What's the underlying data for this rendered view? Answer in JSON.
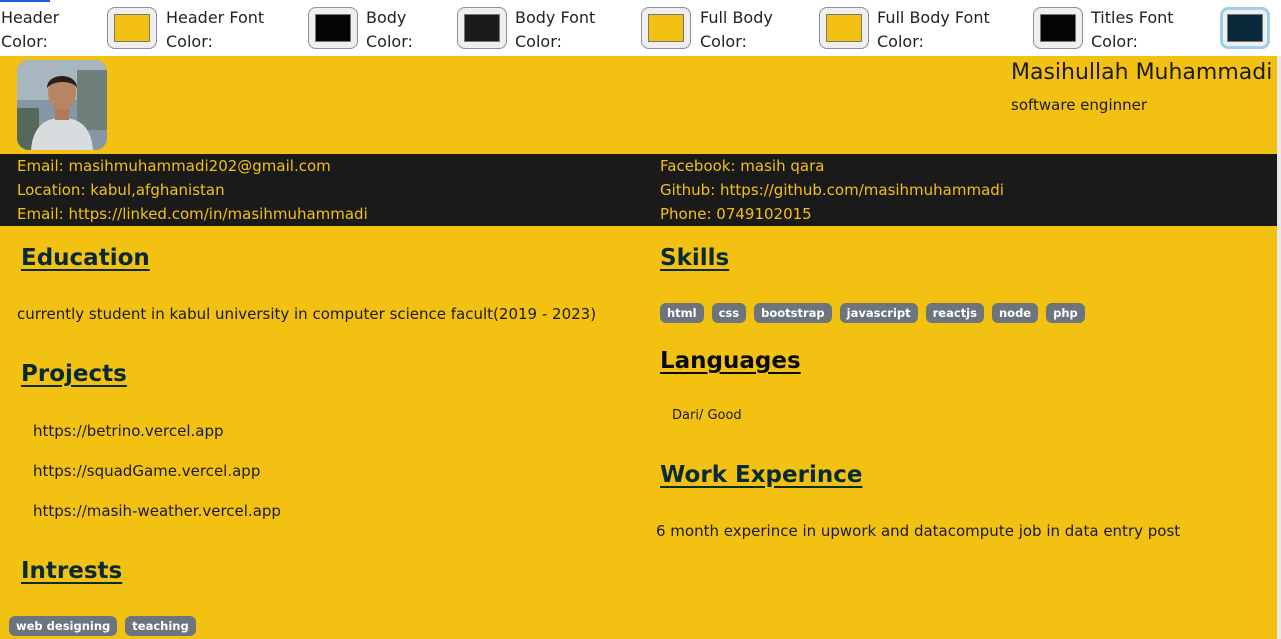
{
  "toolbar": {
    "header_color": {
      "label_line1": "Header",
      "label_line2": "Color:",
      "value": "#f2c112"
    },
    "header_font_color": {
      "label_line1": "Header Font",
      "label_line2": "Color:",
      "value": "#050505"
    },
    "body_color": {
      "label_line1": "Body",
      "label_line2": "Color:",
      "value": "#1a1a1a"
    },
    "body_font_color": {
      "label_line1": "Body Font",
      "label_line2": "Color:",
      "value": "#f2c112"
    },
    "full_body_color": {
      "label_line1": "Full Body",
      "label_line2": "Color:",
      "value": "#f2c112"
    },
    "full_body_font_color": {
      "label_line1": "Full Body Font",
      "label_line2": "Color:",
      "value": "#050505"
    },
    "titles_font_color": {
      "label_line1": "Titles Font",
      "label_line2": "Color:",
      "value": "#0a2a3a"
    }
  },
  "header": {
    "name": "Masihullah Muhammadi",
    "role": "software enginner"
  },
  "contact": {
    "email": "Email: masihmuhammadi202@gmail.com",
    "location": "Location: kabul,afghanistan",
    "linkedin": "Email: https://linked.com/in/masihmuhammadi",
    "facebook": "Facebook: masih qara",
    "github": "Github: https://github.com/masihmuhammadi",
    "phone": "Phone: 0749102015"
  },
  "education": {
    "title": "Education",
    "text": "currently student in kabul university in computer science facult(2019 - 2023)"
  },
  "projects": {
    "title": "Projects",
    "items": [
      "https://betrino.vercel.app",
      "https://squadGame.vercel.app",
      "https://masih-weather.vercel.app"
    ]
  },
  "interests": {
    "title": "Intrests",
    "items": [
      "web designing",
      "teaching"
    ]
  },
  "skills": {
    "title": "Skills",
    "items": [
      "html",
      "css",
      "bootstrap",
      "javascript",
      "reactjs",
      "node",
      "php"
    ]
  },
  "languages": {
    "title": "Languages",
    "items": [
      "Dari/ Good"
    ]
  },
  "work": {
    "title": "Work Experince",
    "text": "6 month experince in upwork and datacompute job in data entry post"
  },
  "colors": {
    "accent": "#f2c112",
    "dark": "#1a1a1a",
    "title_color": "#0a2a33",
    "badge": "#6c757d"
  }
}
